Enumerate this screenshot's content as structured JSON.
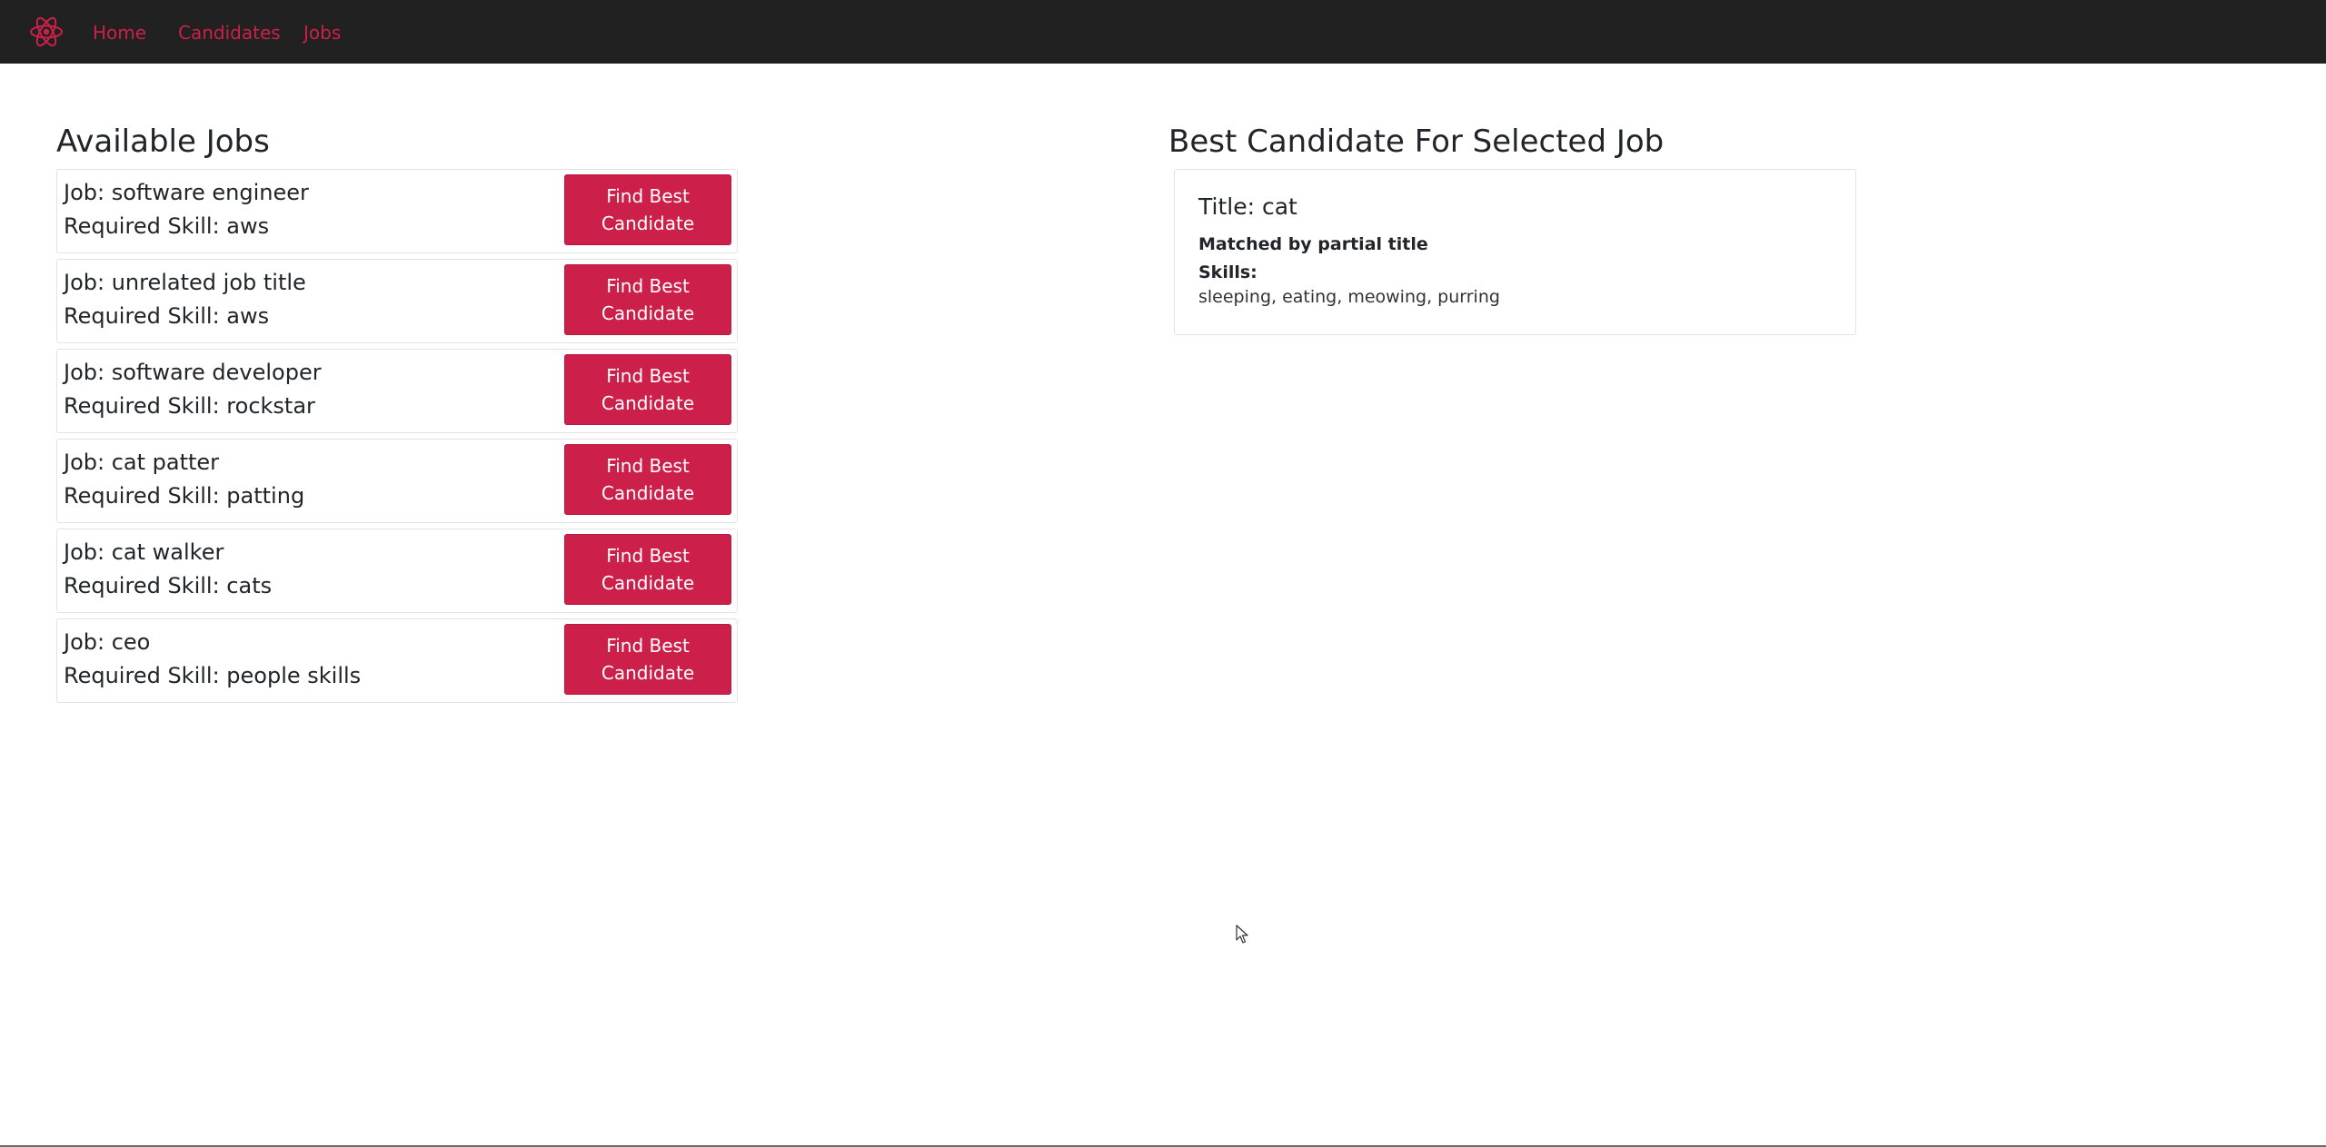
{
  "nav": {
    "brand_icon": "react-atom-icon",
    "links": [
      {
        "label": "Home"
      },
      {
        "label": "Candidates"
      },
      {
        "label": "Jobs"
      }
    ]
  },
  "jobs_section": {
    "title": "Available Jobs",
    "button_label": "Find Best Candidate",
    "jobs": [
      {
        "title": "Job: software engineer",
        "skill": "Required Skill: aws"
      },
      {
        "title": "Job: unrelated job title",
        "skill": "Required Skill: aws"
      },
      {
        "title": "Job: software developer",
        "skill": "Required Skill: rockstar"
      },
      {
        "title": "Job: cat patter",
        "skill": "Required Skill: patting"
      },
      {
        "title": "Job: cat walker",
        "skill": "Required Skill: cats"
      },
      {
        "title": "Job: ceo",
        "skill": "Required Skill: people skills"
      }
    ]
  },
  "best_section": {
    "title": "Best Candidate For Selected Job",
    "candidate": {
      "title": "Title: cat",
      "match": "Matched by partial title",
      "skills_label": "Skills:",
      "skills": "sleeping, eating, meowing, purring"
    }
  },
  "colors": {
    "navbar_bg": "#212121",
    "accent": "#cc1f4a"
  }
}
